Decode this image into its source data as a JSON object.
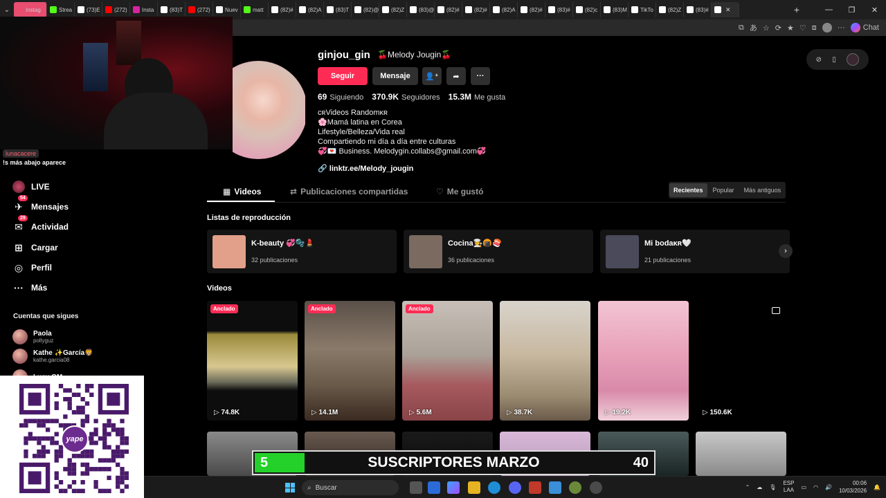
{
  "browser": {
    "tabs": [
      {
        "label": "Instag",
        "color": "#e94d6f",
        "highlight": true
      },
      {
        "label": "Strea",
        "color": "#53fc18"
      },
      {
        "label": "(73)E",
        "color": "#ffffff"
      },
      {
        "label": "(272)",
        "color": "#ff0000"
      },
      {
        "label": "Insta",
        "color": "#d6249f"
      },
      {
        "label": "(83)T",
        "color": "#ffffff"
      },
      {
        "label": "(272)",
        "color": "#ff0000"
      },
      {
        "label": "Nuev",
        "color": "#ffffff"
      },
      {
        "label": "matt",
        "color": "#53fc18"
      },
      {
        "label": "(82)#",
        "color": "#ffffff"
      },
      {
        "label": "(82)A",
        "color": "#ffffff"
      },
      {
        "label": "(83)T",
        "color": "#ffffff"
      },
      {
        "label": "(82)@",
        "color": "#ffffff"
      },
      {
        "label": "(82)Z",
        "color": "#ffffff"
      },
      {
        "label": "(83)@",
        "color": "#ffffff"
      },
      {
        "label": "(82)#",
        "color": "#ffffff"
      },
      {
        "label": "(82)#",
        "color": "#ffffff"
      },
      {
        "label": "(82)A",
        "color": "#ffffff"
      },
      {
        "label": "(82)#",
        "color": "#ffffff"
      },
      {
        "label": "(83)#",
        "color": "#ffffff"
      },
      {
        "label": "(82)c",
        "color": "#ffffff"
      },
      {
        "label": "(83)M",
        "color": "#ffffff"
      },
      {
        "label": "TikTo",
        "color": "#ffffff"
      },
      {
        "label": "(82)Z",
        "color": "#ffffff"
      },
      {
        "label": "(83)#",
        "color": "#ffffff"
      },
      {
        "label": "",
        "color": "#ffffff",
        "active": true
      }
    ],
    "chat_label": "Chat"
  },
  "alert": {
    "name": "lunacacere",
    "message": "!s más abajo aparece"
  },
  "nav": [
    {
      "label": "LIVE",
      "icon": "live-icon",
      "glyph": "◉",
      "badge": ""
    },
    {
      "label": "Mensajes",
      "icon": "messages-icon",
      "glyph": "✈",
      "badge": "54"
    },
    {
      "label": "Actividad",
      "icon": "activity-icon",
      "glyph": "✉",
      "badge": "29"
    },
    {
      "label": "Cargar",
      "icon": "upload-icon",
      "glyph": "⊞",
      "badge": ""
    },
    {
      "label": "Perfil",
      "icon": "profile-icon",
      "glyph": "◎",
      "badge": ""
    },
    {
      "label": "Más",
      "icon": "more-icon",
      "glyph": "···",
      "badge": ""
    }
  ],
  "following": {
    "heading": "Cuentas que sigues",
    "accounts": [
      {
        "name": "Paola",
        "handle": "pollyguz"
      },
      {
        "name": "Kathe ✨García🦁",
        "handle": "kathe.garcia08"
      },
      {
        "name": "Lucy OM",
        "handle": ""
      }
    ]
  },
  "profile": {
    "username": "ginjou_gin",
    "nickname": "🍒Melody Jougin🍒",
    "follow_label": "Seguir",
    "message_label": "Mensaje",
    "more_label": "···",
    "stats": [
      {
        "value": "69",
        "label": "Siguiendo"
      },
      {
        "value": "370.9K",
        "label": "Seguidores"
      },
      {
        "value": "15.3M",
        "label": "Me gusta"
      }
    ],
    "bio": [
      "ᴄʀVideos Randomᴋʀ",
      "🌸Mamá latina en Corea",
      "Lifestyle/Belleza/Vida real",
      "Compartiendo mi día a día entre culturas",
      "💞💌 Business. Melodygin.collabs@gmail.com💞"
    ],
    "link": "linktr.ee/Melody_jougin"
  },
  "tabs": {
    "videos": "Videos",
    "reposts": "Publicaciones compartidas",
    "liked": "Me gustó"
  },
  "sort": {
    "recent": "Recientes",
    "popular": "Popular",
    "oldest": "Más antiguos"
  },
  "playlists": {
    "heading": "Listas de reproducción",
    "items": [
      {
        "title": "K-beauty 💞🫧💄",
        "count": "32 publicaciones",
        "color": "#e2a08a"
      },
      {
        "title": "Cocina👩‍🍳🍘🍣",
        "count": "36 publicaciones",
        "color": "#7a6a60"
      },
      {
        "title": "Mi bodaᴋʀ🤍",
        "count": "21 publicaciones",
        "color": "#4a4a5a"
      }
    ]
  },
  "videos": {
    "heading": "Videos",
    "pinned_label": "Anclado",
    "items": [
      {
        "views": "74.8K",
        "pinned": true,
        "bg": "linear-gradient(#0d0d0d 0%,#0d0d0d 25%,#9a8a3a 28%,#d8c890 55%,#6a6a5a 68%,#0d0d0d 75%)"
      },
      {
        "views": "14.1M",
        "pinned": true,
        "bg": "linear-gradient(#5a5048,#8a7a6a 40%,#6a5a4a 70%,#3a2a20)"
      },
      {
        "views": "5.6M",
        "pinned": true,
        "bg": "linear-gradient(#c8c0b8,#aaa298 45%,#a65a5e 70%,#8a4448)"
      },
      {
        "views": "38.7K",
        "pinned": false,
        "bg": "linear-gradient(#d8d4cc,#c8b8a0 45%,#9a8a70 80%,#6a5a4a)"
      },
      {
        "views": "19.2K",
        "pinned": false,
        "bg": "linear-gradient(#f2c4d4,#e8a0b8 45%,#d88aa8 75%,#f0d0da)"
      },
      {
        "views": "150.6K",
        "pinned": false,
        "bg": "#000"
      }
    ],
    "row2": [
      {
        "bg": "linear-gradient(#8a8a8a,#4a4a4a)"
      },
      {
        "bg": "linear-gradient(#6a5a50,#2a2420)"
      },
      {
        "bg": "linear-gradient(#1a1a1a,#0a0a0a)"
      },
      {
        "bg": "linear-gradient(#d8b8d8,#b89ab8)"
      },
      {
        "bg": "linear-gradient(#4a5a5a,#1a2424)"
      },
      {
        "bg": "linear-gradient(#c8c8c8,#8a8a8a)"
      }
    ]
  },
  "subs_banner": {
    "current": "5",
    "label": "SUSCRIPTORES MARZO",
    "goal": "40",
    "progress": 0.125
  },
  "taskbar": {
    "search_placeholder": "Buscar",
    "lang": "ESP",
    "lang2": "LAA",
    "time": "00:06",
    "date": "10/03/2026"
  }
}
